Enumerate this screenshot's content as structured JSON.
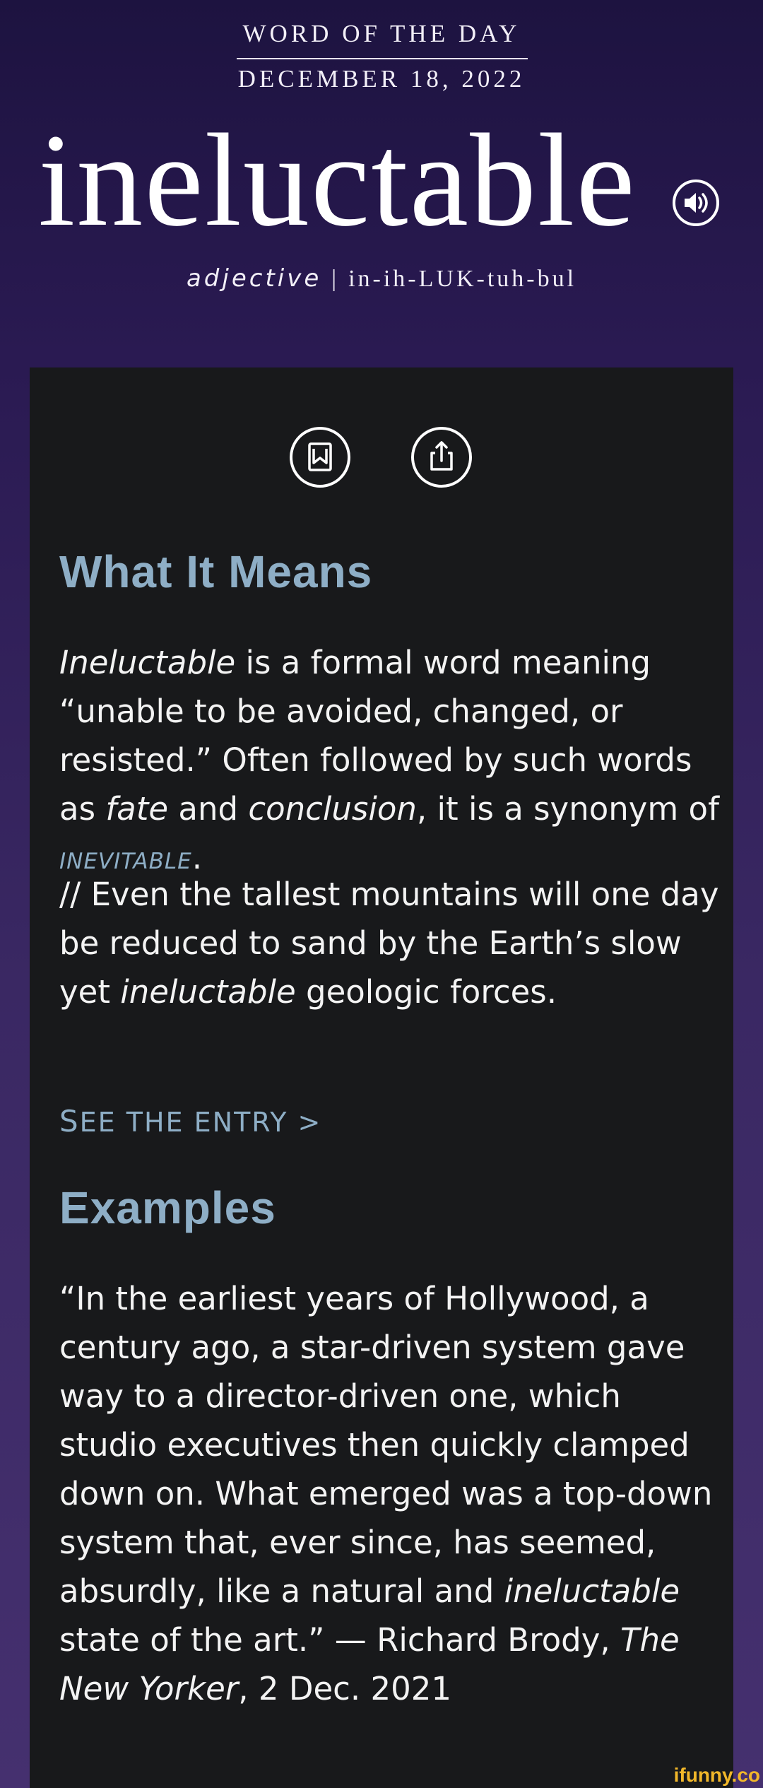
{
  "header": {
    "eyebrow": "WORD OF THE DAY",
    "date": "DECEMBER 18, 2022",
    "word": "ineluctable",
    "part_of_speech": "adjective",
    "separator": "|",
    "pronunciation": "in-ih-LUK-tuh-bul",
    "audio_icon": "speaker-icon"
  },
  "actions": {
    "bookmark_icon": "bookmark-icon",
    "share_icon": "share-icon"
  },
  "meaning": {
    "heading": "What It Means",
    "p1_a": "Ineluctable",
    "p1_b": " is a formal word meaning “unable to be avoided, changed, or resisted.” Often followed by such words as ",
    "p1_c": "fate",
    "p1_d": " and ",
    "p1_e": "conclusion",
    "p1_f": ", it is a synonym of ",
    "p1_g": "INEVITABLE",
    "p1_h": ".",
    "p2_a": "// Even the tallest mountains will one day be reduced to sand by the Earth’s slow yet ",
    "p2_b": "ineluctable",
    "p2_c": " geologic forces.",
    "see_first": "S",
    "see_rest": "EE THE ENTRY >"
  },
  "examples": {
    "heading": "Examples",
    "q_a": "“In the earliest years of Hollywood, a century ago, a star-driven system gave way to a director-driven one, which studio executives then quickly clamped down on. What emerged was a top-down system that, ever since, has seemed, absurdly, like a natural and ",
    "q_b": "ineluctable",
    "q_c": " state of the art.” — Richard Brody, ",
    "q_d": "The New Yorker",
    "q_e": ", 2 Dec. 2021"
  },
  "watermark": "ifunny.co",
  "colors": {
    "accent": "#8eaec6",
    "card_bg": "#18191b",
    "bg_top": "#1d1340",
    "bg_bottom": "#45306f",
    "watermark": "#f1b72a"
  }
}
